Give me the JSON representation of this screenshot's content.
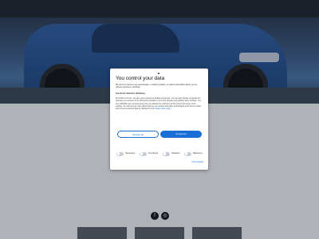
{
  "banner": {
    "logo_text": "▲",
    "title": "You control your data",
    "intro": "We and our partners use technologies, including cookies, to collect information about you for various purposes, including:",
    "purposes": "Functional, Statistics, Marketing",
    "details": "By clicking 'Accept', you give your consent for all these purposes. You can also choose to specify the purposes you consent to by ticking the checkbox next to the purpose and clicking 'Save settings'. You may withdraw your consent at any time by clicking the small icon at the bottom left corner of the website. You can find out more about how we use cookies and other technologies and how we collect and process personal data by clicking the link.",
    "link_text": "Read cookie policy",
    "decline_label": "Decline all",
    "accept_label": "Accept all",
    "toggles": [
      {
        "label": "Necessary"
      },
      {
        "label": "Functional"
      },
      {
        "label": "Statistics"
      },
      {
        "label": "Marketing"
      }
    ],
    "show_details": "Show details"
  },
  "social": {
    "facebook": "f",
    "instagram": "◎"
  },
  "colors": {
    "accent": "#1a6fd6",
    "topbar": "#1b2128"
  }
}
